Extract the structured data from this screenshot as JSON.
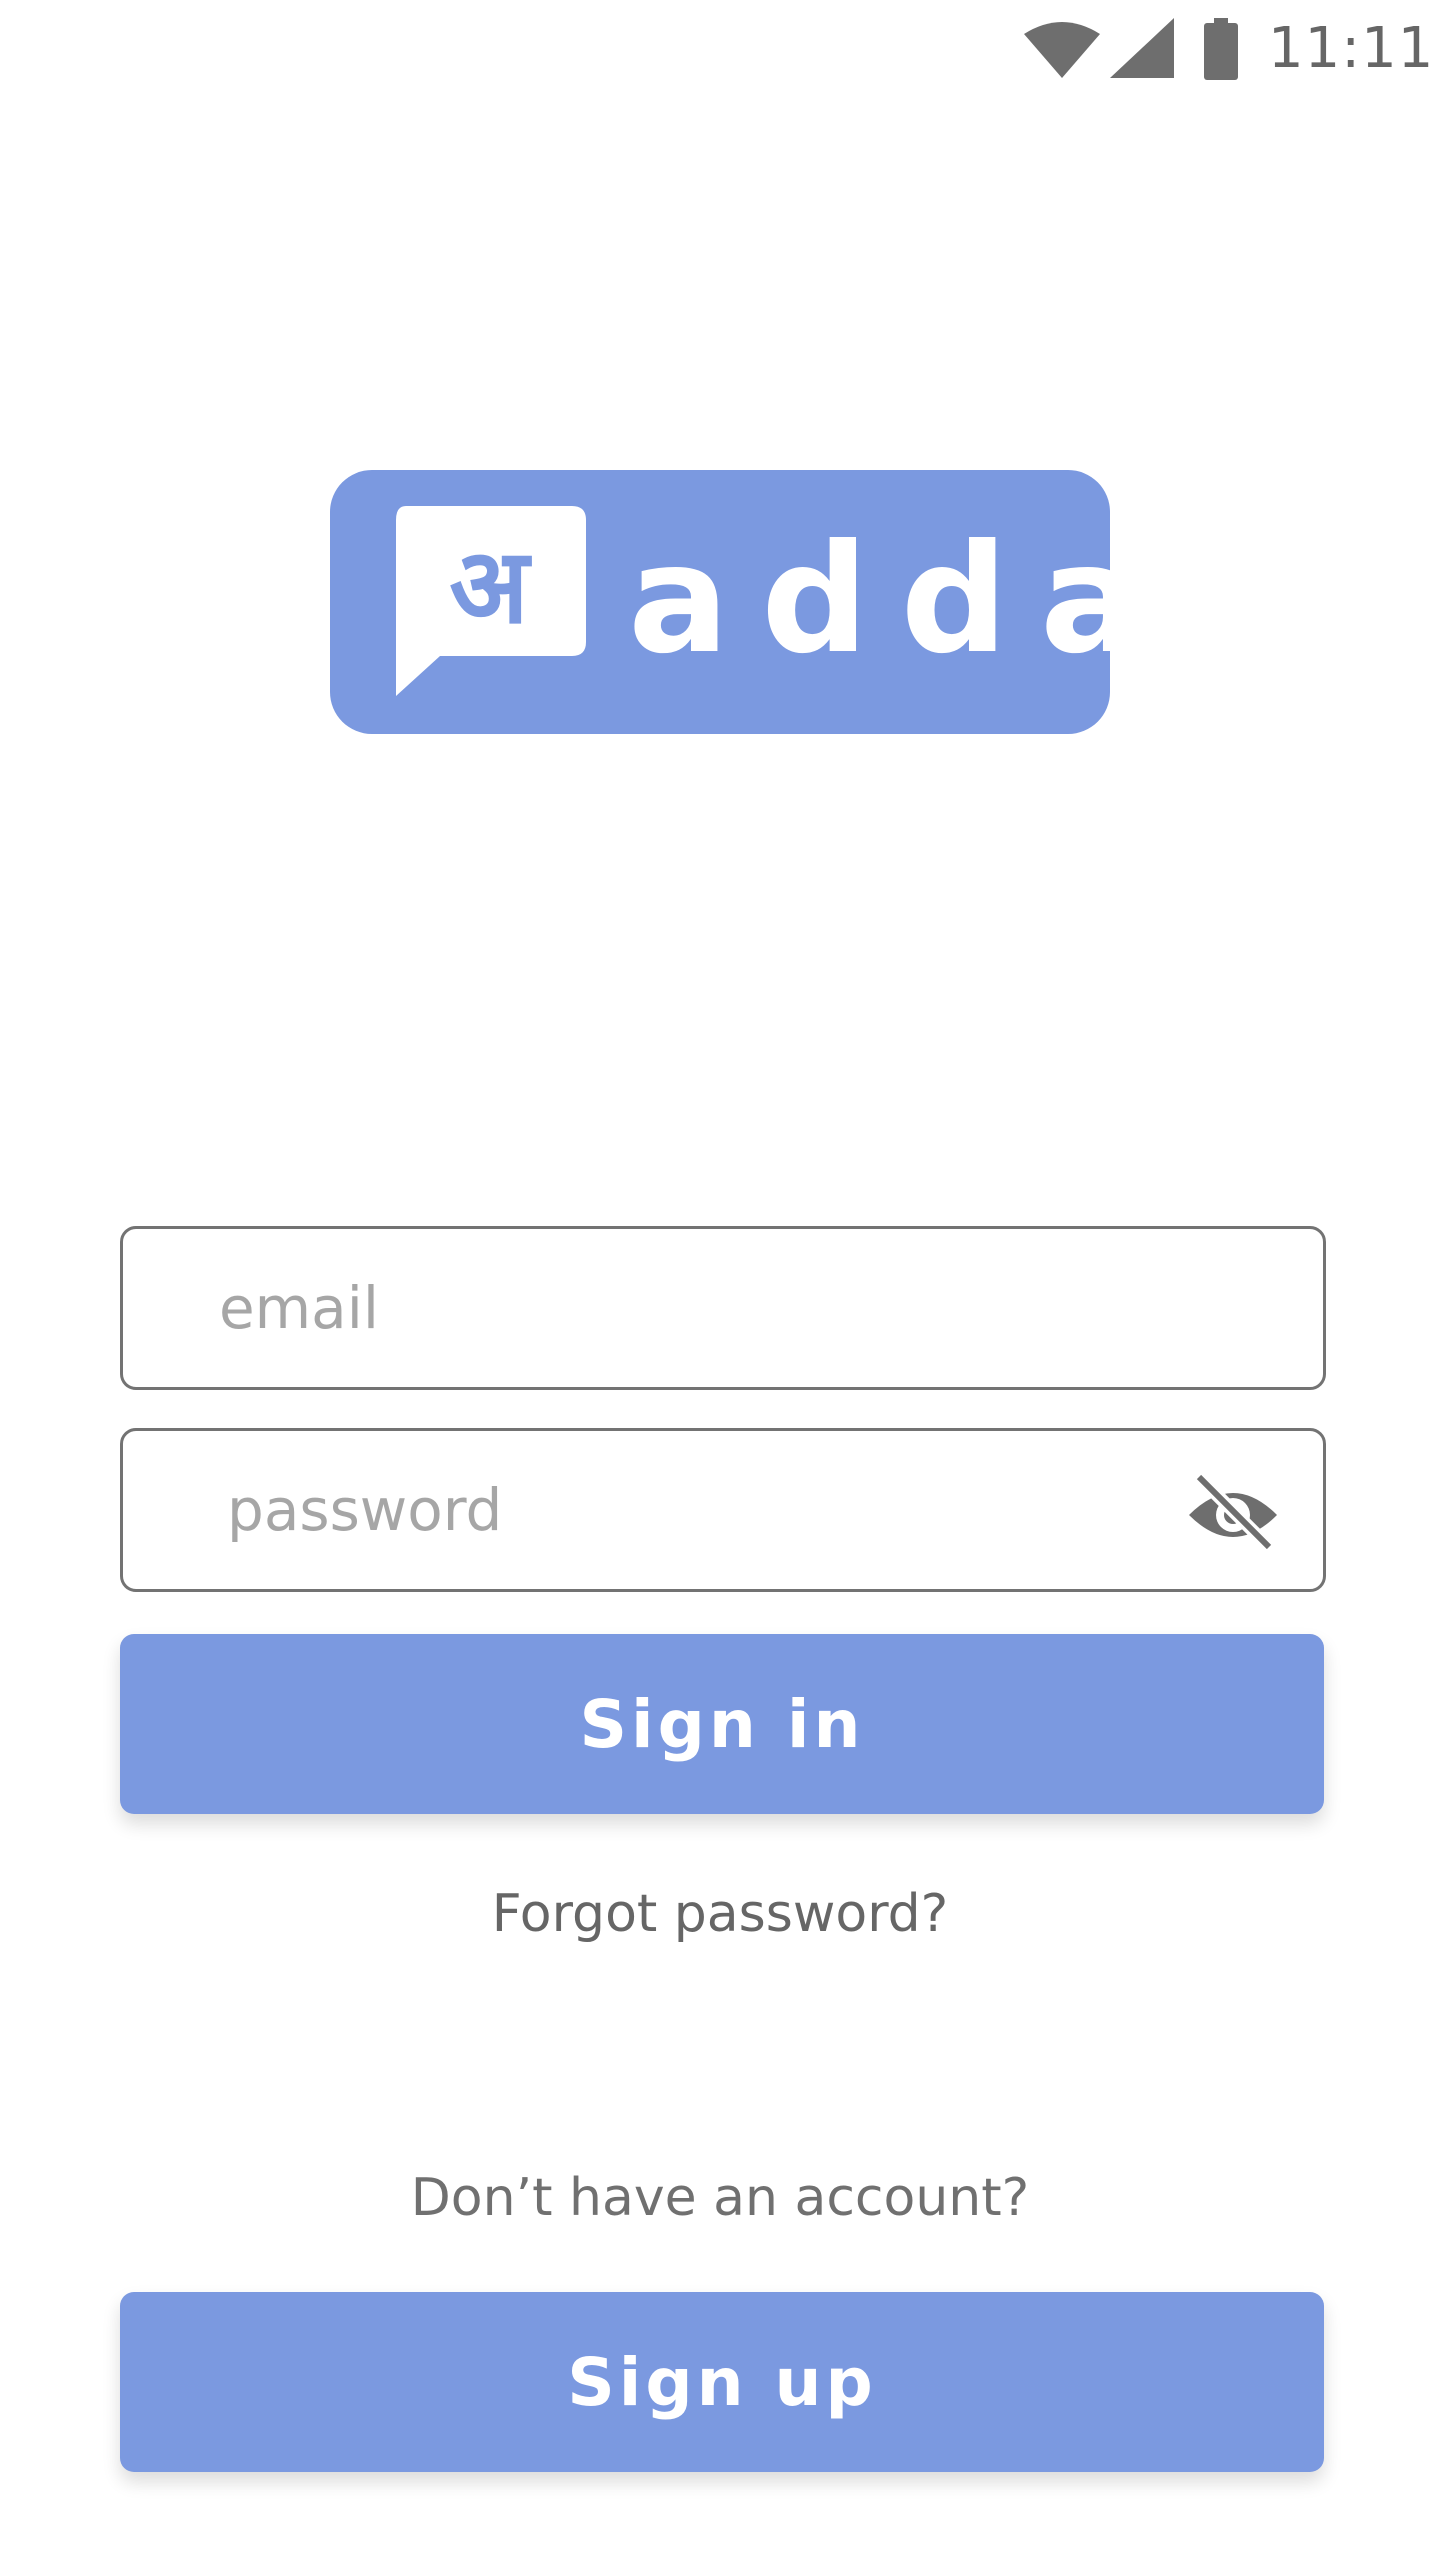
{
  "status_bar": {
    "time": "11:11",
    "icons": [
      "wifi-icon",
      "cellular-signal-icon",
      "battery-icon"
    ]
  },
  "logo": {
    "glyph": "अ",
    "wordmark": "adda",
    "bg_color": "#7b99e0",
    "fg_color": "#ffffff"
  },
  "form": {
    "email_placeholder": "email",
    "email_value": "",
    "password_placeholder": "password",
    "password_value": "",
    "password_toggle_icon": "visibility-off-icon"
  },
  "actions": {
    "signin_label": "Sign in",
    "forgot_label": "Forgot password?",
    "no_account_label": "Don’t have an account?",
    "signup_label": "Sign up"
  },
  "colors": {
    "accent": "#7b99e0",
    "text_muted": "#666666",
    "field_border": "#737373"
  }
}
